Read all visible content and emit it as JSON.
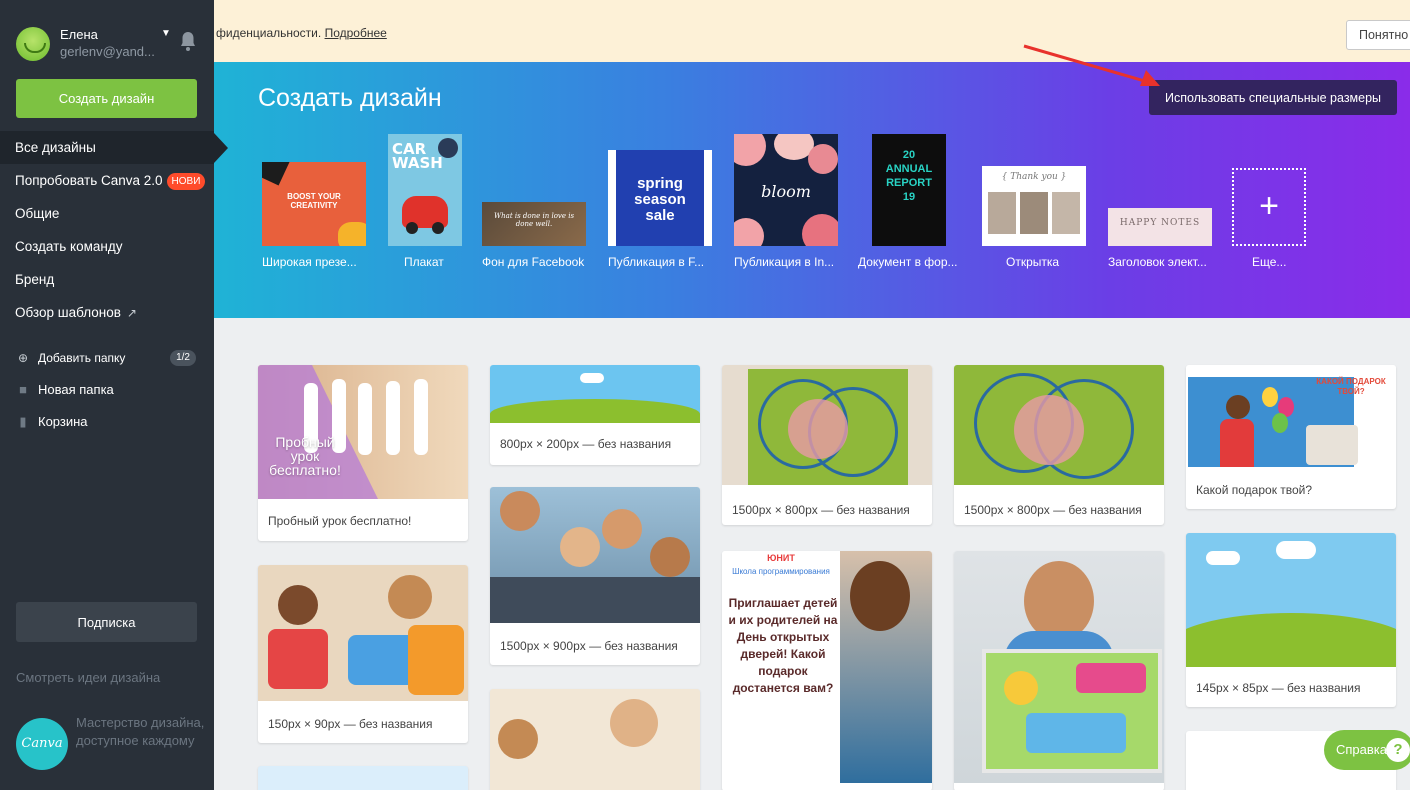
{
  "user": {
    "name": "Елена",
    "email": "gerlenv@yand..."
  },
  "sidebar": {
    "create_label": "Создать дизайн",
    "nav": [
      {
        "label": "Все дизайны"
      },
      {
        "label": "Попробовать Canva 2.0",
        "badge": "НОВИ"
      },
      {
        "label": "Общие"
      },
      {
        "label": "Создать команду"
      },
      {
        "label": "Бренд"
      },
      {
        "label": "Обзор шаблонов"
      }
    ],
    "add_folder": "Добавить папку",
    "folder_count": "1/2",
    "folders": [
      {
        "label": "Новая папка"
      },
      {
        "label": "Корзина"
      }
    ],
    "subscription": "Подписка",
    "ideas": "Смотреть идеи дизайна",
    "logo_text": "Canva",
    "promo": "Мастерство дизайна, доступное каждому"
  },
  "notice": {
    "text": "фиденциальности.",
    "link": "Подробнее",
    "ok": "Понятно"
  },
  "hero": {
    "title": "Создать дизайн",
    "custom_sizes": "Использовать специальные размеры",
    "templates": [
      {
        "label": "Широкая презе...",
        "thumb_text": "BOOST YOUR CREATIVITY"
      },
      {
        "label": "Плакат",
        "thumb_text": "CAR WASH"
      },
      {
        "label": "Фон для Facebook",
        "thumb_text": "What is done in love is done well."
      },
      {
        "label": "Публикация в F...",
        "thumb_text": "spring season sale"
      },
      {
        "label": "Публикация в In...",
        "thumb_text": "bloom"
      },
      {
        "label": "Документ в фор...",
        "thumb_text": "20 ANNUAL REPORT 19"
      },
      {
        "label": "Открытка",
        "thumb_text": "{ Thank you }"
      },
      {
        "label": "Заголовок элект...",
        "thumb_text": "HAPPY NOTES"
      },
      {
        "label": "Еще..."
      }
    ]
  },
  "designs": [
    {
      "caption": "Пробный урок бесплатно!",
      "overlay": "Пробный урок бесплатно!"
    },
    {
      "caption": "150px × 90px — без названия"
    },
    {
      "caption": "800px × 200px — без названия"
    },
    {
      "caption": "1500px × 900px — без названия"
    },
    {
      "caption": "1500px × 800px — без названия"
    },
    {
      "caption": "1500px × 800px — без названия"
    },
    {
      "caption": "Какой подарок твой?",
      "overlay": "КАКОЙ ПОДАРОК ТВОЙ?"
    },
    {
      "caption": "145px × 85px — без названия"
    },
    {
      "overlay_lines": [
        "ЮНИТ",
        "Школа программирования",
        "Приглашает детей и их родителей на День открытых дверей! Какой подарок достанется вам?"
      ]
    }
  ],
  "help": {
    "label": "Справка",
    "icon": "?"
  },
  "colors": {
    "sidebar": "#293039",
    "accent": "#7dc242",
    "badge": "#ff4b2b",
    "notice": "#fdf1d7",
    "custom_btn": "#33245f"
  }
}
